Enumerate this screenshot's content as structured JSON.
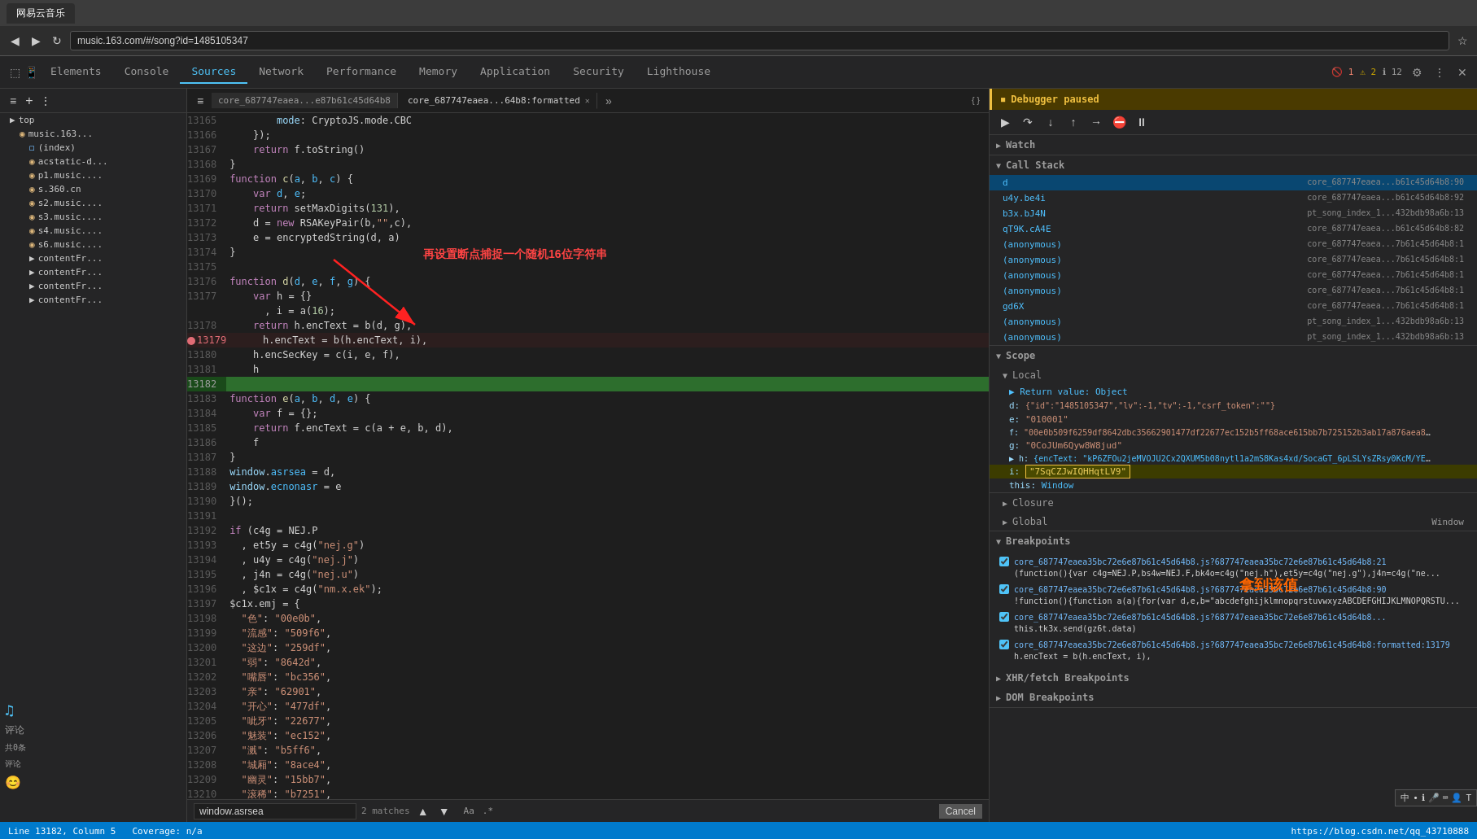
{
  "browser": {
    "address": "music.163.com/#/song?id=1485105347",
    "tab_title": "网易云音乐"
  },
  "devtools": {
    "tabs": [
      "Elements",
      "Console",
      "Sources",
      "Network",
      "Performance",
      "Memory",
      "Application",
      "Security",
      "Lighthouse"
    ],
    "active_tab": "Sources",
    "notifications": {
      "errors": "1",
      "warnings": "2",
      "info": "12"
    }
  },
  "sources": {
    "file_tabs": [
      {
        "name": "core_687747eaea...e87b61c45d64b8",
        "active": false
      },
      {
        "name": "core_687747eaea...64b8:formatted",
        "active": true
      }
    ],
    "search": {
      "query": "window.asrsea",
      "matches": "2 matches",
      "placeholder": "Find"
    },
    "status": {
      "line": "Line 13182, Column 5",
      "coverage": "Coverage: n/a"
    }
  },
  "sidebar_tree": {
    "top_label": "top",
    "items": [
      {
        "indent": 1,
        "icon": "▶",
        "label": "top",
        "type": "folder"
      },
      {
        "indent": 2,
        "icon": "◉",
        "label": "music.163...",
        "type": "folder"
      },
      {
        "indent": 3,
        "icon": "",
        "label": "(index)",
        "type": "file"
      },
      {
        "indent": 3,
        "icon": "◉",
        "label": "acstatic-d...",
        "type": "folder"
      },
      {
        "indent": 3,
        "icon": "◉",
        "label": "p1.music...",
        "type": "folder"
      },
      {
        "indent": 3,
        "icon": "◉",
        "label": "s.360.cn",
        "type": "folder"
      },
      {
        "indent": 3,
        "icon": "◉",
        "label": "s2.music...",
        "type": "folder"
      },
      {
        "indent": 3,
        "icon": "◉",
        "label": "s3.music...",
        "type": "folder"
      },
      {
        "indent": 3,
        "icon": "◉",
        "label": "s4.music...",
        "type": "folder"
      },
      {
        "indent": 3,
        "icon": "◉",
        "label": "s6.music...",
        "type": "folder"
      },
      {
        "indent": 3,
        "icon": "▶",
        "label": "contentFr...",
        "type": "folder"
      },
      {
        "indent": 3,
        "icon": "▶",
        "label": "contentFr...",
        "type": "folder"
      },
      {
        "indent": 3,
        "icon": "▶",
        "label": "contentFr...",
        "type": "folder"
      },
      {
        "indent": 3,
        "icon": "▶",
        "label": "contentFr...",
        "type": "folder"
      }
    ]
  },
  "code_lines": [
    {
      "num": "13165",
      "content": "        mode: CryptoJS.mode.CBC"
    },
    {
      "num": "13166",
      "content": "    });"
    },
    {
      "num": "13167",
      "content": "    return f.toString()"
    },
    {
      "num": "13168",
      "content": "}"
    },
    {
      "num": "13169",
      "content": "function c(a, b, c) {"
    },
    {
      "num": "13170",
      "content": "    var d, e;"
    },
    {
      "num": "13171",
      "content": "    return setMaxDigits(131),"
    },
    {
      "num": "13172",
      "content": "    d = new RSAKeyPair(b,\"\",c),"
    },
    {
      "num": "13173",
      "content": "    e = encryptedString(d, a)"
    },
    {
      "num": "13174",
      "content": "}"
    },
    {
      "num": "13175",
      "content": ""
    },
    {
      "num": "13176",
      "content": "function d(d, e, f, g) {"
    },
    {
      "num": "13177",
      "content": "    var h = {}"
    },
    {
      "num": "13177",
      "content": "      , i = a(16);"
    },
    {
      "num": "13178",
      "content": "    return h.encText = b(d, g),"
    },
    {
      "num": "13179",
      "content": "    h.encText = b(h.encText, i),",
      "bp": true
    },
    {
      "num": "13180",
      "content": "    h.encSecKey = c(i, e, f),"
    },
    {
      "num": "13181",
      "content": "    h"
    },
    {
      "num": "13182",
      "content": "",
      "current": true,
      "highlighted": true
    },
    {
      "num": "13183",
      "content": "function e(a, b, d, e) {"
    },
    {
      "num": "13184",
      "content": "    var f = {};"
    },
    {
      "num": "13185",
      "content": "    return f.encText = c(a + e, b, d),"
    },
    {
      "num": "13186",
      "content": "    f"
    },
    {
      "num": "13187",
      "content": "}"
    },
    {
      "num": "13188",
      "content": "window.asrsea = d,"
    },
    {
      "num": "13189",
      "content": "window.ecnonasr = e"
    },
    {
      "num": "13190",
      "content": "}();"
    },
    {
      "num": "13191",
      "content": ""
    },
    {
      "num": "13192",
      "content": "if (c4g = NEJ.P"
    },
    {
      "num": "13193",
      "content": "  , et5y = c4g(\"nej.g\")"
    },
    {
      "num": "13194",
      "content": "  , u4y = c4g(\"nej.j\")"
    },
    {
      "num": "13195",
      "content": "  , j4n = c4g(\"nej.u\")"
    },
    {
      "num": "13196",
      "content": "  , $c1x = c4g(\"nm.x.ek\");"
    },
    {
      "num": "13197",
      "content": "$c1x.emj = {"
    },
    {
      "num": "13198",
      "content": "  \"色\": \"00e0b\","
    },
    {
      "num": "13199",
      "content": "  \"流感\": \"509f6\","
    },
    {
      "num": "13200",
      "content": "  \"这边\": \"259df\","
    },
    {
      "num": "13201",
      "content": "  \"弱\": \"8642d\","
    },
    {
      "num": "13202",
      "content": "  \"嘴唇\": \"bc356\","
    },
    {
      "num": "13203",
      "content": "  \"亲\": \"62901\","
    },
    {
      "num": "13204",
      "content": "  \"开心\": \"477df\","
    },
    {
      "num": "13205",
      "content": "  \"呲牙\": \"22677\","
    },
    {
      "num": "13206",
      "content": "  \"魅装\": \"ec152\","
    },
    {
      "num": "13207",
      "content": "  \"溅\": \"b5ff6\","
    },
    {
      "num": "13208",
      "content": "  \"城厢\": \"8ace4\","
    },
    {
      "num": "13209",
      "content": "  \"幽灵\": \"15bb7\","
    },
    {
      "num": "13210",
      "content": "  \"滚稀\": \"b7251\","
    },
    {
      "num": "13211",
      "content": ""
    }
  ],
  "right_panel": {
    "debugger_paused": "Debugger paused",
    "sections": {
      "watch": "Watch",
      "call_stack": "Call Stack",
      "scope": "Scope",
      "closure": "Closure",
      "global": "Global",
      "breakpoints": "Breakpoints"
    },
    "call_stack": [
      {
        "name": "d",
        "file": "core_687747eaea...b61c45d64b8:90",
        "active": true
      },
      {
        "name": "u4y.be4i",
        "file": "core_687747eaea...b61c45d64b8:92"
      },
      {
        "name": "b3x.bJ4N",
        "file": "pt_song_index_1...432bdb98a6b:13"
      },
      {
        "name": "qT9K.cA4E",
        "file": "core_687747eaea...b61c45d64b8:82"
      },
      {
        "name": "(anonymous)",
        "file": "core_687747eaea...7b61c45d64b8:1"
      },
      {
        "name": "(anonymous)",
        "file": "core_687747eaea...7b61c45d64b8:1"
      },
      {
        "name": "(anonymous)",
        "file": "core_687747eaea...7b61c45d64b8:1"
      },
      {
        "name": "(anonymous)",
        "file": "core_687747eaea...7b61c45d64b8:1"
      },
      {
        "name": "gd6X",
        "file": "core_687747eaea...7b61c45d64b8:1"
      },
      {
        "name": "(anonymous)",
        "file": "pt_song_index_1...432bdb98a6b:13"
      },
      {
        "name": "(anonymous)",
        "file": "pt_song_index_1...432bdb98a6b:13"
      }
    ],
    "scope_local": {
      "title": "Local",
      "return_value": "▶ Return value: Object",
      "d_value": "d: {\"id\":\"1485105347\",\"lv\":-1,\"tv\":-1,\"csrf_token\":\"\"}",
      "e_value": "e: \"010001\"",
      "f_value": "f: \"00e0b509f6259df8642dbc35662901477df22677ec152b5ff68ace615bb7b725152b3ab17a876aea8a...",
      "g_value": "g: \"0CoJUm6Qyw8W8jud\"",
      "h_value": "▶ h: {encText: \"kP6ZFOu2jeMVOJU2Cx2QXUM5b08nytl1a2mS8Kas4xd/SocaGT_6pLSLYsZRsy0KcM/YE9PB...",
      "i_value": "i: \"7SqCZJwIQHHqtLV9\"",
      "this_value": "this: Window"
    },
    "scope_closure": "Closure",
    "scope_global": "Global",
    "global_window": "Window",
    "breakpoints": [
      {
        "checked": true,
        "file": "core_687747eaea35bc72e6e87b61c45d64b8.js?687747eaea35bc72e6e87b61c45d64b8:21",
        "text": "(function(){var c4g=NEJ.P,bs4w=NEJ.F,bk4o=c4g(\"nej.h\"),et5y=c4g(\"nej.g\"),j4n=c4g(\"ne..."
      },
      {
        "checked": true,
        "file": "core_687747eaea35bc72e6e87b61c45d64b8.js?687747eaea35bc72e6e87b61c45d64b8:90",
        "text": "!function(){function a(a){for(var d,e,b=\"abcdefghijklmnopqrstuvwxyzABCDEFGHIJKLMNOPQRSTU..."
      },
      {
        "checked": true,
        "file": "core_687747eaea35bc72e6e87b61c45d64b8.js?687747eaea35bc72e6e87b61c45d64b8...",
        "text": "this.tk3x.send(gz6t.data)"
      },
      {
        "checked": true,
        "file": "core_687747eaea35bc72e6e87b61c45d64b8.js?687747eaea35bc72e6e87b61c45d64b8:formatted:13179",
        "text": "h.encText = b(h.encText, i),"
      }
    ],
    "xhr_fetch_breakpoints": "XHR/fetch Breakpoints",
    "dom_breakpoints": "DOM Breakpoints"
  },
  "annotations": {
    "arrow_text": "再设置断点捕捉一个随机16位字符串",
    "result_text": "拿到该值"
  },
  "footer_link": "https://blog.csdn.net/qq_43710888"
}
